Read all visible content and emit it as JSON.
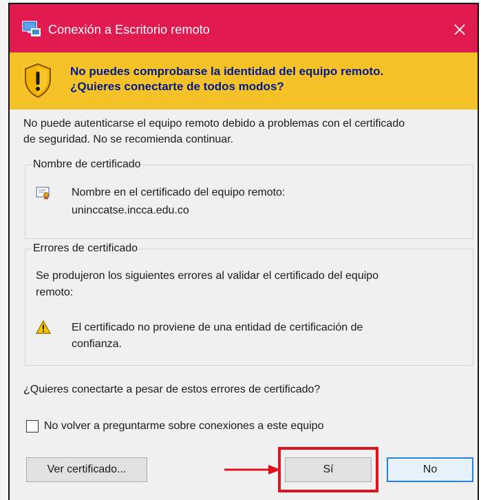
{
  "window": {
    "title": "Conexión a Escritorio remoto",
    "close_glyph": "✕",
    "titlebar_color": "#e11a50"
  },
  "banner": {
    "icon": "warning-shield-icon",
    "line1": "No puedes comprobarse la identidad del equipo remoto.",
    "line2": "¿Quieres conectarte de todos modos?",
    "background": "#f6c22a",
    "text_color": "#001a8c"
  },
  "message": {
    "line1": "No puede autenticarse el equipo remoto debido a problemas con el certificado",
    "line2": "de seguridad. No se recomienda continuar."
  },
  "certificate_name": {
    "heading": "Nombre de certificado",
    "icon": "certificate-icon",
    "label": "Nombre en el certificado del equipo remoto:",
    "value": "uninccatse.incca.edu.co"
  },
  "certificate_errors": {
    "heading": "Errores de certificado",
    "intro_line1": "Se produjeron los siguientes errores al validar el certificado del equipo",
    "intro_line2": "remoto:",
    "icon": "warning-icon",
    "error_line1": "El certificado no proviene de una entidad de certificación de",
    "error_line2": "confianza."
  },
  "question": "¿Quieres conectarte a pesar de estos errores de certificado?",
  "checkbox": {
    "label": "No volver a preguntarme sobre conexiones a este equipo",
    "checked": false
  },
  "buttons": {
    "view_certificate": "Ver certificado...",
    "yes": "Sí",
    "no": "No"
  },
  "annotation": {
    "highlight_color": "#e0151b"
  }
}
